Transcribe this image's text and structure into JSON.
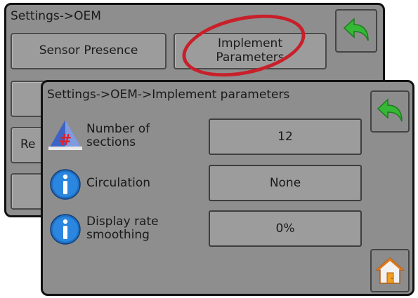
{
  "back_screen": {
    "title": "Settings->OEM",
    "sensor_presence_label": "Sensor Presence",
    "implement_parameters_label": "Implement Parameters",
    "partial_label": "Re"
  },
  "front_screen": {
    "title": "Settings->OEM->Implement parameters",
    "rows": [
      {
        "label": "Number of sections",
        "value": "12",
        "icon": "sections-hash-icon"
      },
      {
        "label": "Circulation",
        "value": "None",
        "icon": "info-icon"
      },
      {
        "label": "Display rate smoothing",
        "value": "0%",
        "icon": "info-icon"
      }
    ]
  },
  "icons": {
    "back": "back-arrow-icon",
    "home": "home-icon"
  },
  "colors": {
    "panel": "#8e8e8e",
    "highlight": "#c8202a",
    "back_arrow": "#35b835",
    "info": "#1f6fc4"
  }
}
